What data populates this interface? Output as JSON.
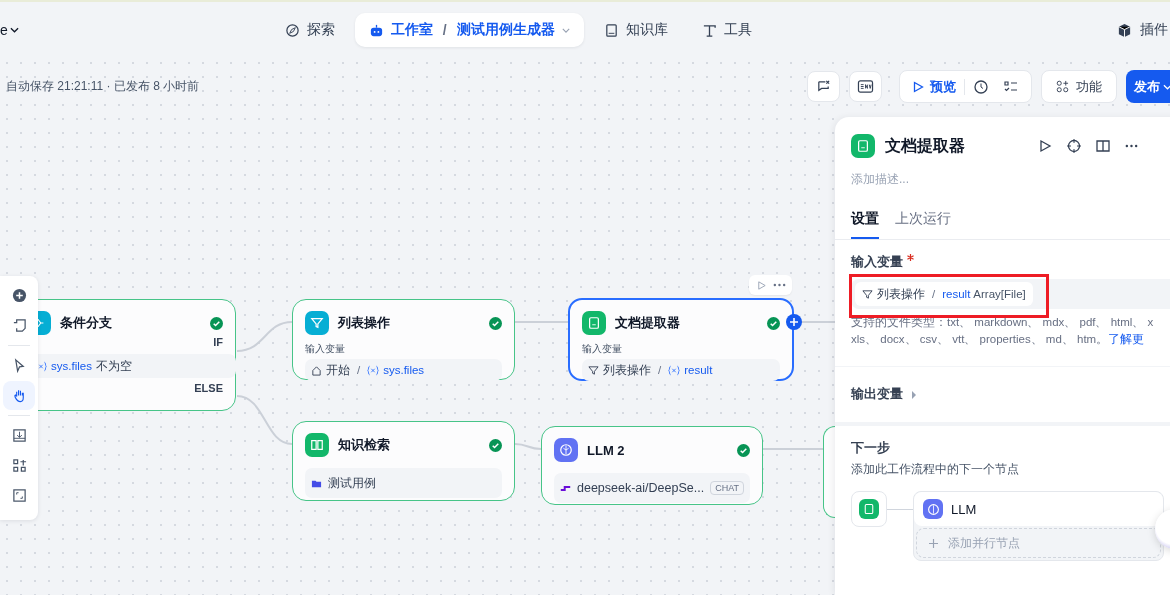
{
  "nav": {
    "workspace_tail": "e",
    "items": [
      {
        "kind": "explore",
        "label": "探索",
        "selected": false
      },
      {
        "kind": "studio",
        "label": "工作室",
        "selected": true,
        "separator": "/",
        "sub": "测试用例生成器"
      },
      {
        "kind": "knowledge",
        "label": "知识库",
        "selected": false
      },
      {
        "kind": "tools",
        "label": "工具",
        "selected": false
      }
    ],
    "plugins": "插件"
  },
  "toolbar": {
    "status": "自动保存 21:21:11 · 已发布 8 小时前",
    "preview": "预览",
    "features": "功能",
    "publish": "发布"
  },
  "canvas_tools": [
    {
      "kind": "add",
      "selected": false
    },
    {
      "kind": "note",
      "selected": false
    },
    {
      "kind": "pointer",
      "selected": false
    },
    {
      "kind": "hand",
      "selected": true
    },
    {
      "kind": "export",
      "selected": false
    },
    {
      "kind": "organize",
      "selected": false
    },
    {
      "kind": "fit",
      "selected": false
    }
  ],
  "nodes": [
    {
      "kind": "condition",
      "title": "条件分支",
      "color": "#06aed4",
      "selected": false,
      "if_label": "IF",
      "else_label": "ELSE",
      "variable": "sys.files",
      "operator": "不为空"
    },
    {
      "kind": "list",
      "title": "列表操作",
      "color": "#06aed4",
      "selected": false,
      "input_label": "输入变量",
      "source": "开始",
      "separator": "/",
      "variable": "sys.files"
    },
    {
      "kind": "doc",
      "title": "文档提取器",
      "color": "#12b76a",
      "selected": true,
      "input_label": "输入变量",
      "source": "列表操作",
      "separator": "/",
      "variable": "result"
    },
    {
      "kind": "knowledge",
      "title": "知识检索",
      "color": "#12b76a",
      "selected": false,
      "dataset": "测试用例"
    },
    {
      "kind": "llm",
      "title": "LLM 2",
      "color": "#6172f3",
      "selected": false,
      "model": "deepseek-ai/DeepSe...",
      "mode": "CHAT"
    },
    {
      "kind": "partial"
    }
  ],
  "panel": {
    "title": "文档提取器",
    "description_placeholder": "添加描述...",
    "tabs": [
      {
        "label": "设置",
        "selected": true
      },
      {
        "label": "上次运行",
        "selected": false
      }
    ],
    "input": {
      "label": "输入变量",
      "required": true,
      "source": "列表操作",
      "separator": "/",
      "variable": "result",
      "type": "Array[File]",
      "highlighted": true,
      "help_lines": [
        "支持的文件类型：txt、 markdown、 mdx、 pdf、 html、 x",
        "xls、 docx、 csv、 vtt、 properties、 md、 htm。"
      ],
      "help_link": "了解更"
    },
    "output": {
      "label": "输出变量",
      "expanded": false
    },
    "next": {
      "title": "下一步",
      "description": "添加此工作流程中的下一个节点",
      "nodes": [
        {
          "label": "LLM"
        }
      ],
      "add_parallel": "添加并行节点"
    }
  }
}
